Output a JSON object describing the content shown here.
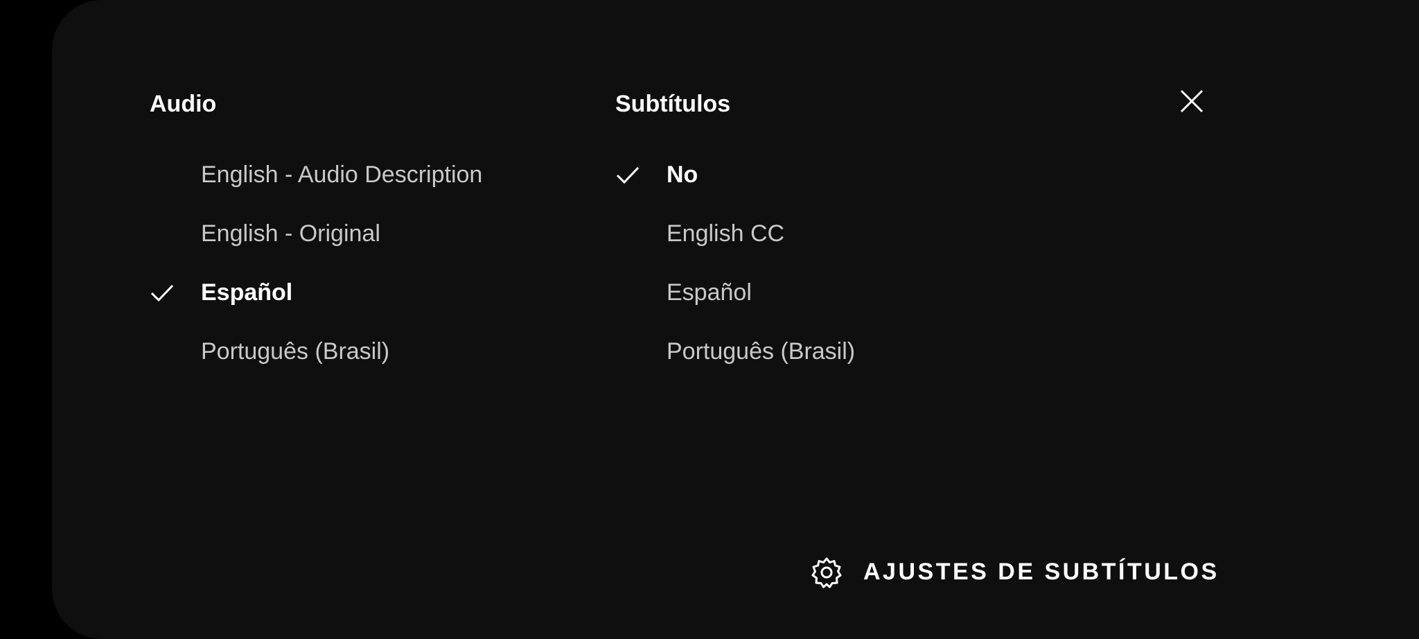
{
  "audio": {
    "title": "Audio",
    "options": [
      {
        "label": "English - Audio Description",
        "selected": false
      },
      {
        "label": "English - Original",
        "selected": false
      },
      {
        "label": "Español",
        "selected": true
      },
      {
        "label": "Português (Brasil)",
        "selected": false
      }
    ]
  },
  "subtitles": {
    "title": "Subtítulos",
    "options": [
      {
        "label": "No",
        "selected": true
      },
      {
        "label": "English CC",
        "selected": false
      },
      {
        "label": "Español",
        "selected": false
      },
      {
        "label": "Português (Brasil)",
        "selected": false
      }
    ]
  },
  "settings_button": {
    "label": "AJUSTES DE SUBTÍTULOS",
    "icon": "gear-icon"
  },
  "close_button": {
    "icon": "close-icon"
  },
  "colors": {
    "panel_background": "#0f0f0f",
    "screen_background": "#000000",
    "selected_text": "#ffffff",
    "unselected_text": "#c9c9c9"
  }
}
